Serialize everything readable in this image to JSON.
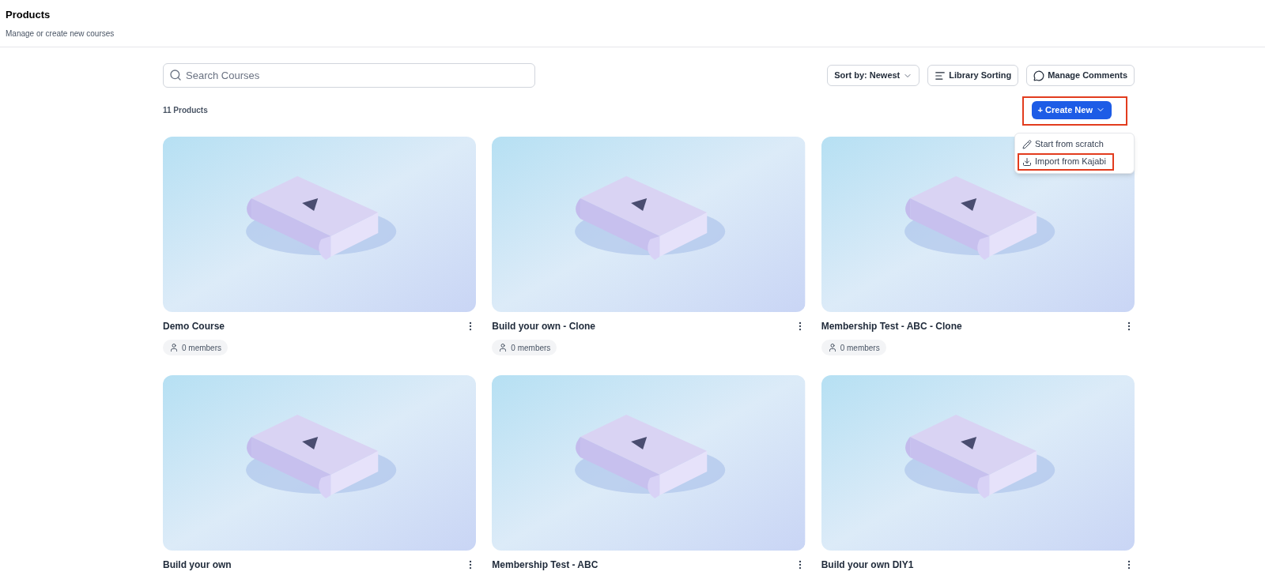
{
  "header": {
    "title": "Products",
    "subtitle": "Manage or create new courses"
  },
  "search": {
    "placeholder": "Search Courses"
  },
  "toolbar": [
    {
      "kind": "sort",
      "label": "Sort by: Newest"
    },
    {
      "kind": "library",
      "label": "Library Sorting"
    },
    {
      "kind": "comments",
      "label": "Manage Comments"
    }
  ],
  "count": "11 Products",
  "create_button": {
    "label": "+ Create New",
    "highlighted": true,
    "expanded": true
  },
  "create_menu": [
    {
      "kind": "scratch",
      "label": "Start from scratch",
      "highlighted": false
    },
    {
      "kind": "import",
      "label": "Import from Kajabi",
      "highlighted": true
    }
  ],
  "products": [
    {
      "title": "Demo Course",
      "members": "0 members"
    },
    {
      "title": "Build your own - Clone",
      "members": "0 members"
    },
    {
      "title": "Membership Test - ABC - Clone",
      "members": "0 members"
    },
    {
      "title": "Build your own"
    },
    {
      "title": "Membership Test - ABC"
    },
    {
      "title": "Build your own DIY1"
    }
  ]
}
